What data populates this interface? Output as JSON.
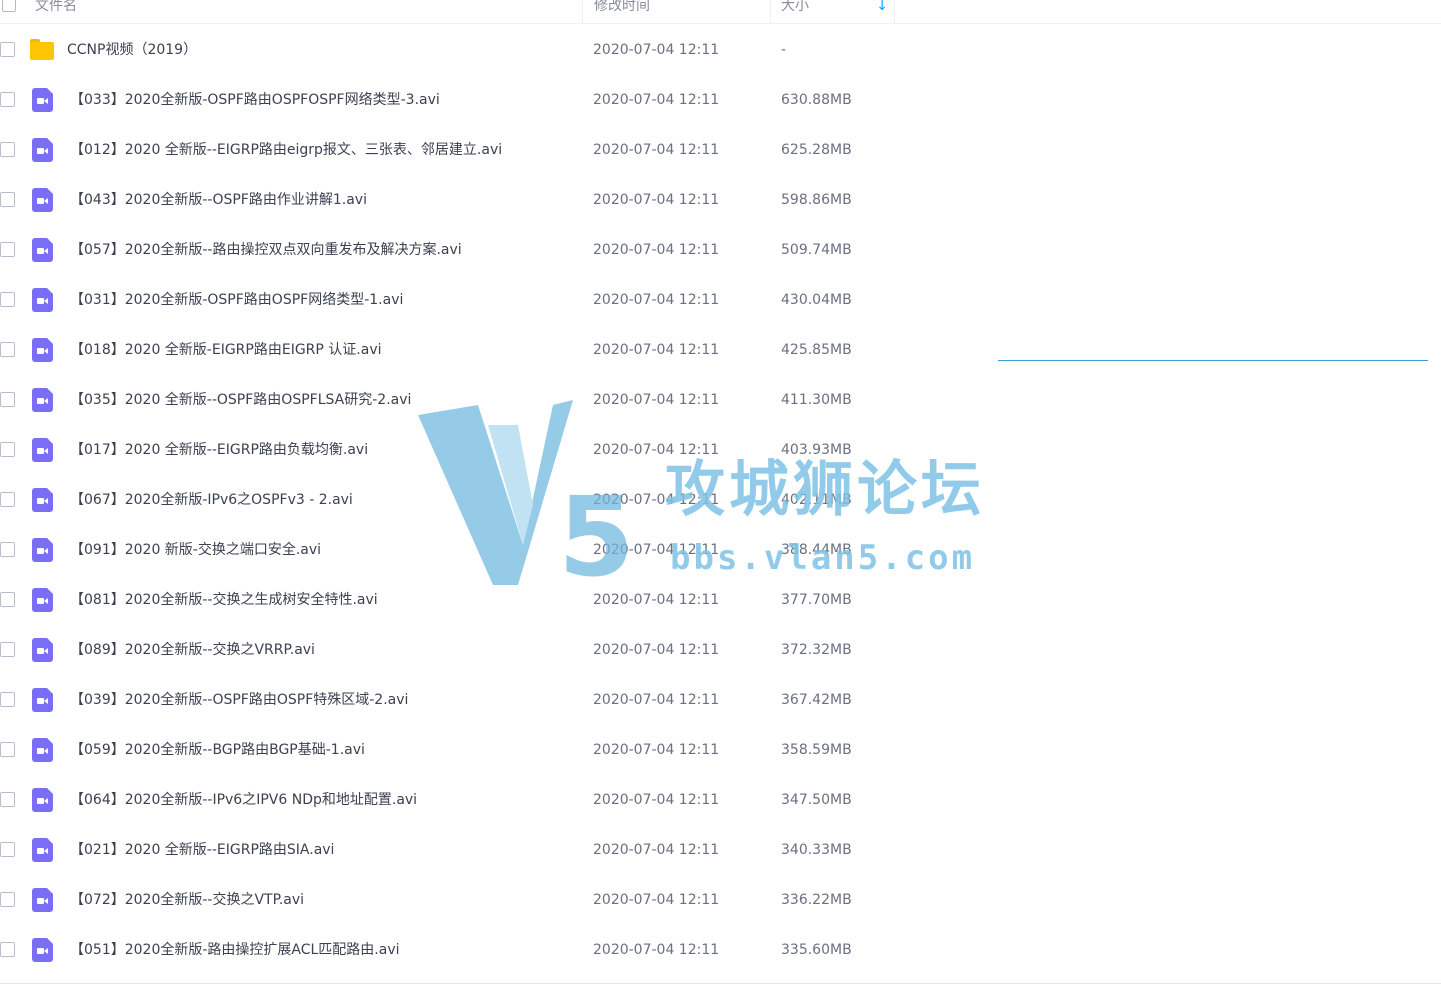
{
  "header": {
    "name_label": "文件名",
    "time_label": "修改时间",
    "size_label": "大小",
    "sort_icon": "arrow-down-icon"
  },
  "files": [
    {
      "type": "folder",
      "name": "CCNP视频（2019）",
      "time": "2020-07-04 12:11",
      "size": "-"
    },
    {
      "type": "video",
      "name": "【033】2020全新版-OSPF路由OSPFOSPF网络类型-3.avi",
      "time": "2020-07-04 12:11",
      "size": "630.88MB"
    },
    {
      "type": "video",
      "name": "【012】2020 全新版--EIGRP路由eigrp报文、三张表、邻居建立.avi",
      "time": "2020-07-04 12:11",
      "size": "625.28MB"
    },
    {
      "type": "video",
      "name": "【043】2020全新版--OSPF路由作业讲解1.avi",
      "time": "2020-07-04 12:11",
      "size": "598.86MB"
    },
    {
      "type": "video",
      "name": "【057】2020全新版--路由操控双点双向重发布及解决方案.avi",
      "time": "2020-07-04 12:11",
      "size": "509.74MB"
    },
    {
      "type": "video",
      "name": "【031】2020全新版-OSPF路由OSPF网络类型-1.avi",
      "time": "2020-07-04 12:11",
      "size": "430.04MB"
    },
    {
      "type": "video",
      "name": "【018】2020 全新版-EIGRP路由EIGRP 认证.avi",
      "time": "2020-07-04 12:11",
      "size": "425.85MB"
    },
    {
      "type": "video",
      "name": "【035】2020 全新版--OSPF路由OSPFLSA研究-2.avi",
      "time": "2020-07-04 12:11",
      "size": "411.30MB"
    },
    {
      "type": "video",
      "name": "【017】2020 全新版--EIGRP路由负载均衡.avi",
      "time": "2020-07-04 12:11",
      "size": "403.93MB"
    },
    {
      "type": "video",
      "name": "【067】2020全新版-IPv6之OSPFv3 - 2.avi",
      "time": "2020-07-04 12:11",
      "size": "402.11MB"
    },
    {
      "type": "video",
      "name": "【091】2020 新版-交换之端口安全.avi",
      "time": "2020-07-04 12:11",
      "size": "388.44MB"
    },
    {
      "type": "video",
      "name": "【081】2020全新版--交换之生成树安全特性.avi",
      "time": "2020-07-04 12:11",
      "size": "377.70MB"
    },
    {
      "type": "video",
      "name": "【089】2020全新版--交换之VRRP.avi",
      "time": "2020-07-04 12:11",
      "size": "372.32MB"
    },
    {
      "type": "video",
      "name": "【039】2020全新版--OSPF路由OSPF特殊区域-2.avi",
      "time": "2020-07-04 12:11",
      "size": "367.42MB"
    },
    {
      "type": "video",
      "name": "【059】2020全新版--BGP路由BGP基础-1.avi",
      "time": "2020-07-04 12:11",
      "size": "358.59MB"
    },
    {
      "type": "video",
      "name": "【064】2020全新版--IPv6之IPV6 NDp和地址配置.avi",
      "time": "2020-07-04 12:11",
      "size": "347.50MB"
    },
    {
      "type": "video",
      "name": "【021】2020 全新版--EIGRP路由SIA.avi",
      "time": "2020-07-04 12:11",
      "size": "340.33MB"
    },
    {
      "type": "video",
      "name": "【072】2020全新版--交换之VTP.avi",
      "time": "2020-07-04 12:11",
      "size": "336.22MB"
    },
    {
      "type": "video",
      "name": "【051】2020全新版-路由操控扩展ACL匹配路由.avi",
      "time": "2020-07-04 12:11",
      "size": "335.60MB"
    }
  ],
  "watermark": {
    "title": "攻城狮论坛",
    "url": "bbs.vlan5.com",
    "color": "#7fc3e6"
  },
  "colors": {
    "folder": "#ffc402",
    "video": "#7b6ef6",
    "accent": "#06a7ff"
  }
}
